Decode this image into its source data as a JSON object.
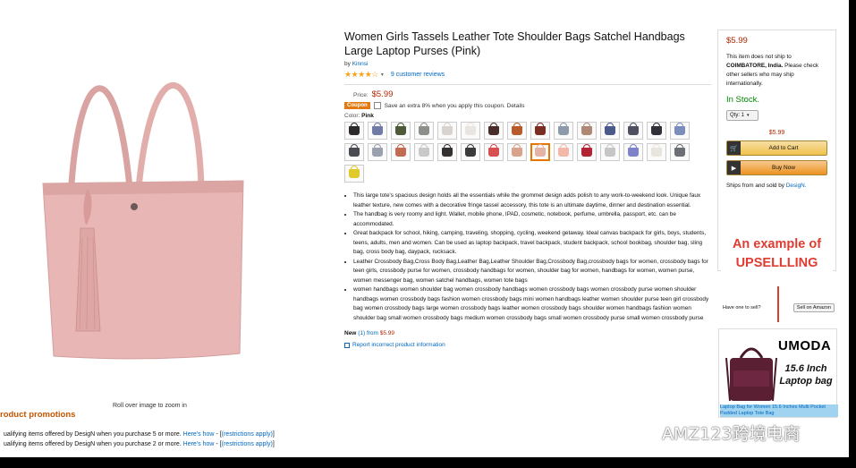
{
  "product": {
    "title": "Women Girls Tassels Leather Tote Shoulder Bags Satchel Handbags Large Laptop Purses (Pink)",
    "by_label": "by",
    "brand": "Kinnsi",
    "stars": "★★★★☆",
    "rating_fraction": 0.8,
    "review_count": "9 customer reviews",
    "price_label": "Price:",
    "price": "$5.99",
    "coupon_badge": "Coupon",
    "coupon_text": "Save an extra 8% when you apply this coupon. Details",
    "color_label": "Color:",
    "color_value": "Pink",
    "zoom_hint": "Roll over image to zoom in",
    "swatch_colors": [
      "#2c2a2b",
      "#6f7aa6",
      "#4c5a3a",
      "#8d8f8a",
      "#d8d3cc",
      "#e9e5e0",
      "#4a2c2a",
      "#b85a2a",
      "#7a2e23",
      "#8c9aa9",
      "#b08976",
      "#4a5a8a",
      "#4e5062",
      "#2f3038",
      "#7b8dbb",
      "#4a4a52",
      "#9aa0ad",
      "#c36b52",
      "#c9c9c9",
      "#33302f",
      "#3b3b3e",
      "#d84f4f",
      "#d8a38a",
      "#e5b2a6",
      "#f2b8a9",
      "#b02433",
      "#c6c6c6",
      "#7e82c9",
      "#e8e4de",
      "#6b6e72",
      "#e0c92a"
    ],
    "selected_swatch": 23,
    "bullets": [
      "This large tote's spacious design holds all the essentials while the grommet design adds polish to any work-to-weekend look. Unique faux leather texture, new comes with a decorative fringe tassel accessory, this tote is an ultimate daytime, dinner and destination essential.",
      "The handbag is very roomy and light. Wallet, mobile phone, IPAD, cosmetic, notebook, perfume, umbrella, passport, etc. can be accommodated.",
      "Great backpack for school, hiking, camping, traveling, shopping, cycling, weekend getaway. Ideal canvas backpack for girls, boys, students, teens, adults, men and women. Can be used as laptop backpack, travel backpack, student backpack, school bookbag, shoulder bag, sling bag, cross body bag, daypack, rucksack.",
      "Leather Crossbody Bag,Cross Body Bag,Leather Bag,Leather Shoulder Bag,Crossbody Bag,crossbody bags for women, crossbody bags for teen girls, crossbody purse for women, crossbody handbags for women, shoulder bag for women, handbags for women, women purse, women messenger bag, women satchel handbags, women tote bags",
      "women handbags women shoulder bag women crossbody handbags women crossbody bags women crossbody purse women shoulder handbags women crossbody bags fashion women crossbody bags mini women handbags leather women shoulder purse teen girl crossbody bag women crossbody bags large women crossbody bags leather women crossbody bags shoulder women handbags fashion women shoulder bag small women crossbody bags medium women crossbody bags small women crossbody purse small women crossbody purse"
    ],
    "new_label": "New",
    "new_from": "(1) from",
    "new_price": "$5.99",
    "report_text": "Report incorrect product information"
  },
  "buybox": {
    "price": "$5.99",
    "ship_text_1": "This item does not ship to",
    "ship_location": "COIMBATORE, India.",
    "ship_text_2": "Please check other sellers who may ship internationally.",
    "stock": "In Stock.",
    "qty": "Qty: 1",
    "price2": "$5.99",
    "add_to_cart": "Add to Cart",
    "buy_now": "Buy Now",
    "sold_by": "Ships from and sold by",
    "seller": "DesigN."
  },
  "annotation": {
    "upsell_text": "An example of UPSELLLING"
  },
  "sell": {
    "question": "Have one to sell?",
    "button": "Sell on Amazon"
  },
  "ad": {
    "brand": "UMODA",
    "sub": "15.6 Inch Laptop bag",
    "caption": "Laptop Bag for Women 15.6 Inches Multi Pocket Padded Laptop Tote Bag"
  },
  "promotions": {
    "title": "roduct promotions",
    "line1_text": "ualifying items offered by DesigN when you purchase 5 or more.",
    "line1_link": "Here's how",
    "line1_tail": "(restrictions apply)",
    "line2_text": "ualifying items offered by DesigN when you purchase 2 or more.",
    "line2_link": "Here's how",
    "line2_tail": "(restrictions apply)"
  },
  "watermark": "AMZ123跨境电商",
  "colors": {
    "price": "#b12704",
    "link": "#0066c0",
    "bag": "#e8b6b4",
    "upsell": "#e03c31"
  }
}
